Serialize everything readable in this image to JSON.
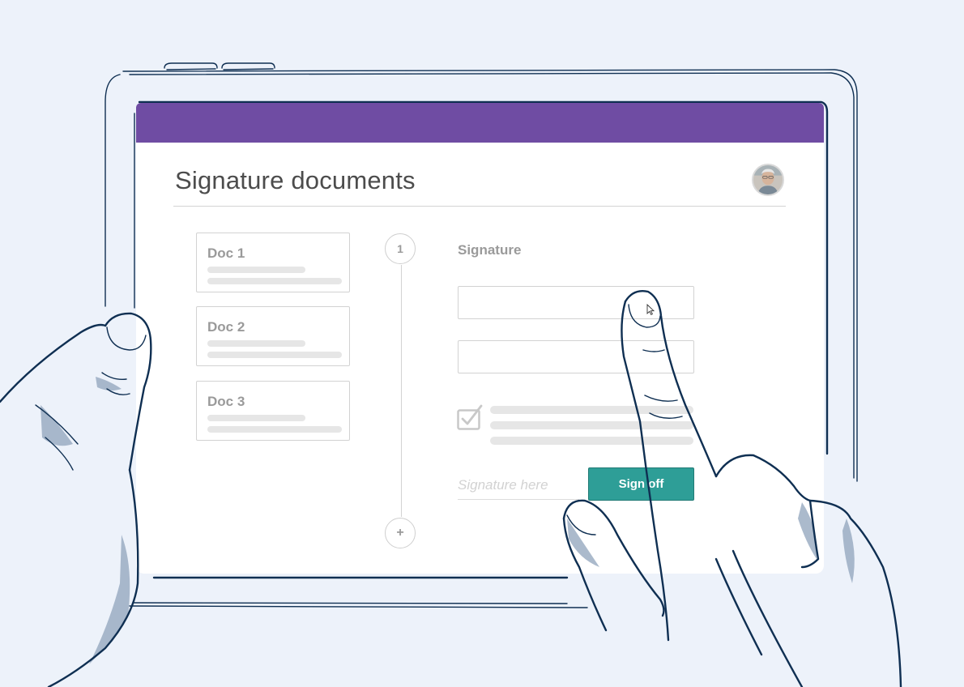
{
  "header": {
    "title": "Signature documents",
    "accent_color": "#6f4ca3",
    "avatar": "user-avatar"
  },
  "documents": [
    {
      "label": "Doc 1"
    },
    {
      "label": "Doc 2"
    },
    {
      "label": "Doc 3"
    }
  ],
  "stepper": {
    "current_step": "1",
    "add_step": "+"
  },
  "form": {
    "section_title": "Signature",
    "signature_placeholder": "Signature here",
    "sign_off_label": "Sign off",
    "button_color": "#2e9e97",
    "checkbox_checked": true
  },
  "icons": {
    "checkbox": "checkbox-checked-icon",
    "cursor": "mouse-pointer-icon"
  }
}
